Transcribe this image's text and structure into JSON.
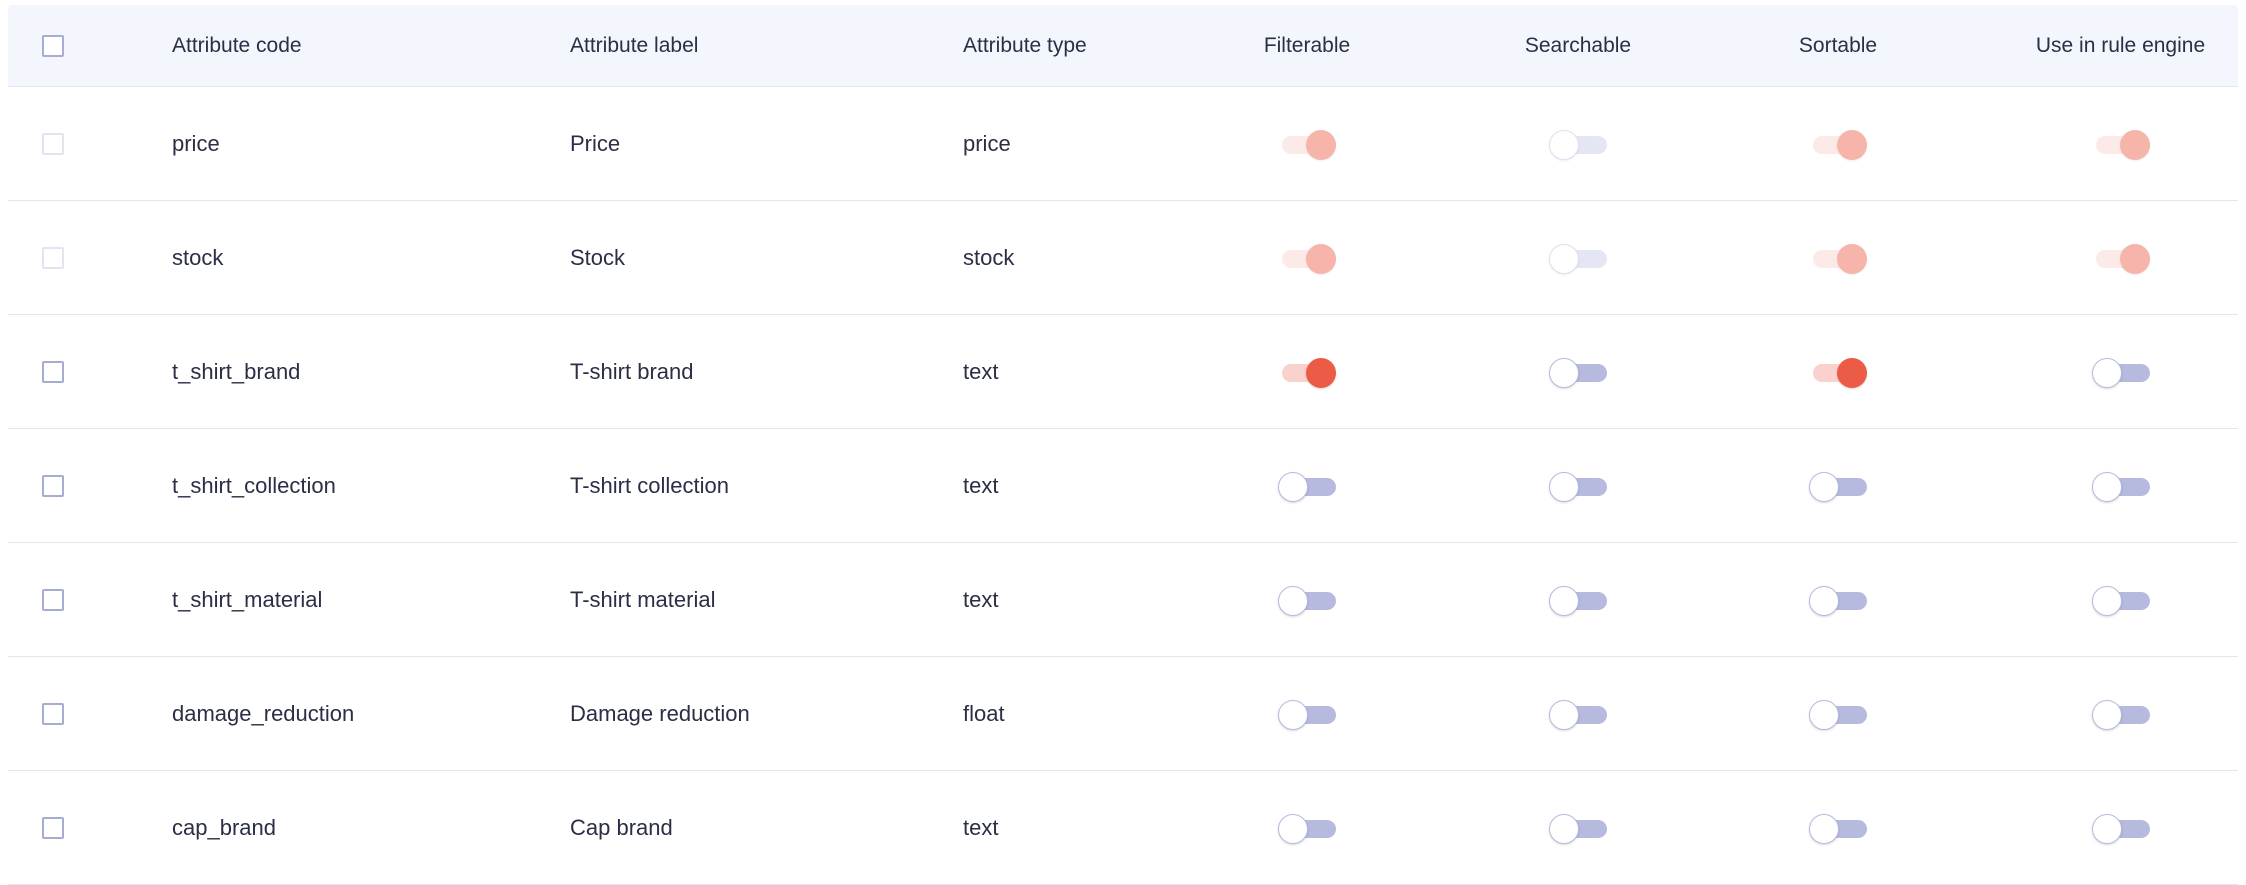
{
  "columns": {
    "code": "Attribute code",
    "label": "Attribute label",
    "type": "Attribute type",
    "filterable": "Filterable",
    "searchable": "Searchable",
    "sortable": "Sortable",
    "rule_engine": "Use in rule engine"
  },
  "colors": {
    "toggle_on": "#ec5b46",
    "toggle_off_track": "#b6badf",
    "header_bg": "#f3f6fd"
  },
  "rows": [
    {
      "code": "price",
      "label": "Price",
      "type": "price",
      "disabled": true,
      "filterable": true,
      "searchable": false,
      "sortable": true,
      "rule_engine": true
    },
    {
      "code": "stock",
      "label": "Stock",
      "type": "stock",
      "disabled": true,
      "filterable": true,
      "searchable": false,
      "sortable": true,
      "rule_engine": true
    },
    {
      "code": "t_shirt_brand",
      "label": "T-shirt brand",
      "type": "text",
      "disabled": false,
      "filterable": true,
      "searchable": false,
      "sortable": true,
      "rule_engine": false
    },
    {
      "code": "t_shirt_collection",
      "label": "T-shirt collection",
      "type": "text",
      "disabled": false,
      "filterable": false,
      "searchable": false,
      "sortable": false,
      "rule_engine": false
    },
    {
      "code": "t_shirt_material",
      "label": "T-shirt material",
      "type": "text",
      "disabled": false,
      "filterable": false,
      "searchable": false,
      "sortable": false,
      "rule_engine": false
    },
    {
      "code": "damage_reduction",
      "label": "Damage reduction",
      "type": "float",
      "disabled": false,
      "filterable": false,
      "searchable": false,
      "sortable": false,
      "rule_engine": false
    },
    {
      "code": "cap_brand",
      "label": "Cap brand",
      "type": "text",
      "disabled": false,
      "filterable": false,
      "searchable": false,
      "sortable": false,
      "rule_engine": false
    }
  ]
}
